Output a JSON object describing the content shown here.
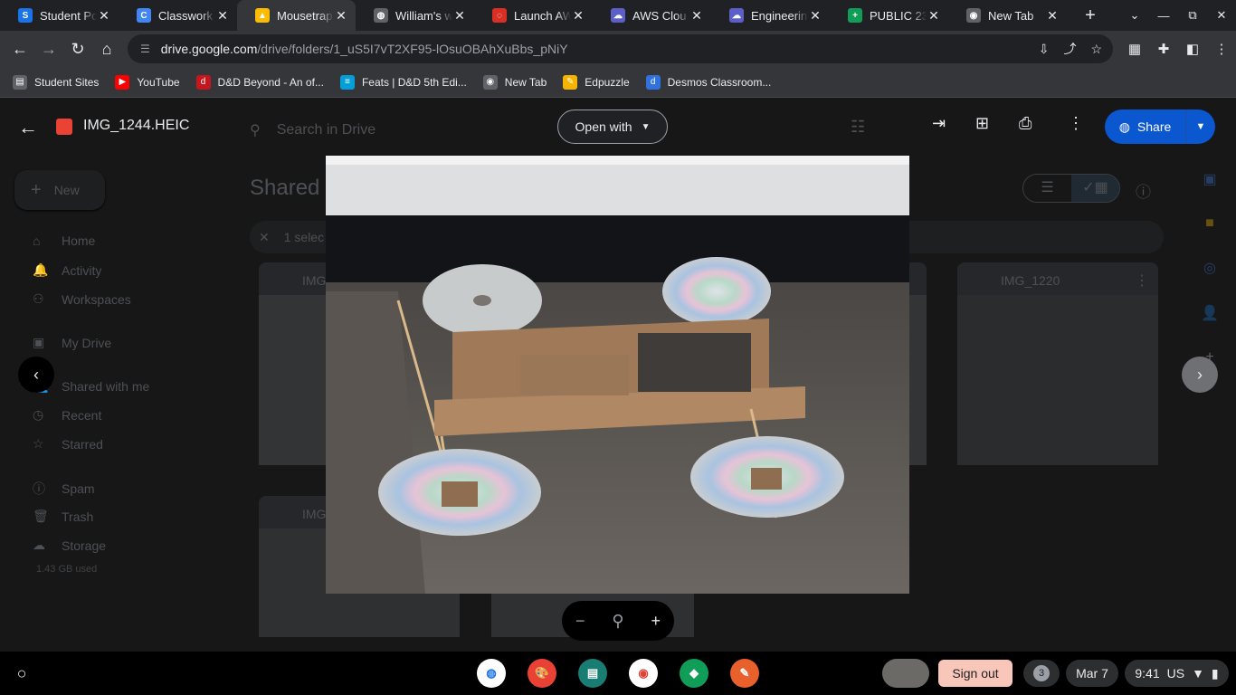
{
  "browser": {
    "tabs": [
      {
        "title": "Student Po",
        "color": "#1a73e8",
        "glyph": "S"
      },
      {
        "title": "Classwork",
        "color": "#4285f4",
        "glyph": "C"
      },
      {
        "title": "Mousetrap",
        "color": "#fbbc04",
        "glyph": "▲"
      },
      {
        "title": "William's w",
        "color": "#5f6368",
        "glyph": "◍"
      },
      {
        "title": "Launch AW",
        "color": "#d93025",
        "glyph": "◌"
      },
      {
        "title": "AWS Clou",
        "color": "#5b5fc7",
        "glyph": "☁"
      },
      {
        "title": "Engineerin",
        "color": "#5b5fc7",
        "glyph": "☁"
      },
      {
        "title": "PUBLIC 23",
        "color": "#0f9d58",
        "glyph": "+"
      },
      {
        "title": "New Tab",
        "color": "#5f6368",
        "glyph": "◉"
      }
    ],
    "url_host": "drive.google.com",
    "url_path": "/drive/folders/1_uS5I7vT2XF95-lOsuOBAhXuBbs_pNiY"
  },
  "bookmarks": [
    {
      "label": "Student Sites",
      "color": "#5f6368",
      "glyph": "▤"
    },
    {
      "label": "YouTube",
      "color": "#ff0000",
      "glyph": "▶"
    },
    {
      "label": "D&D Beyond - An of...",
      "color": "#c4161c",
      "glyph": "d"
    },
    {
      "label": "Feats | D&D 5th Edi...",
      "color": "#049fd9",
      "glyph": "≡"
    },
    {
      "label": "New Tab",
      "color": "#5f6368",
      "glyph": "◉"
    },
    {
      "label": "Edpuzzle",
      "color": "#f5b400",
      "glyph": "✎"
    },
    {
      "label": "Desmos Classroom...",
      "color": "#2f72dc",
      "glyph": "d"
    }
  ],
  "drive": {
    "search_placeholder": "Search in Drive",
    "new_label": "New",
    "page_title": "Shared",
    "selection_text": "1 selec",
    "nav": [
      {
        "label": "Home",
        "icon": "⌂"
      },
      {
        "label": "Activity",
        "icon": "🔔"
      },
      {
        "label": "Workspaces",
        "icon": "⚇"
      },
      {
        "label": "My Drive",
        "icon": "▣"
      },
      {
        "label": "Shared with me",
        "icon": "👥"
      },
      {
        "label": "Recent",
        "icon": "◷"
      },
      {
        "label": "Starred",
        "icon": "☆"
      },
      {
        "label": "Spam",
        "icon": "ⓘ"
      },
      {
        "label": "Trash",
        "icon": "🗑"
      },
      {
        "label": "Storage",
        "icon": "☁"
      }
    ],
    "storage_used": "1.43 GB used",
    "card_labels": [
      "IMG",
      "IMG_1220",
      "IMG"
    ]
  },
  "viewer": {
    "filename": "IMG_1244.HEIC",
    "open_with_label": "Open with",
    "share_label": "Share"
  },
  "shelf": {
    "sign_out_label": "Sign out",
    "notification_count": "3",
    "date": "Mar 7",
    "time": "9:41",
    "locale": "US"
  }
}
